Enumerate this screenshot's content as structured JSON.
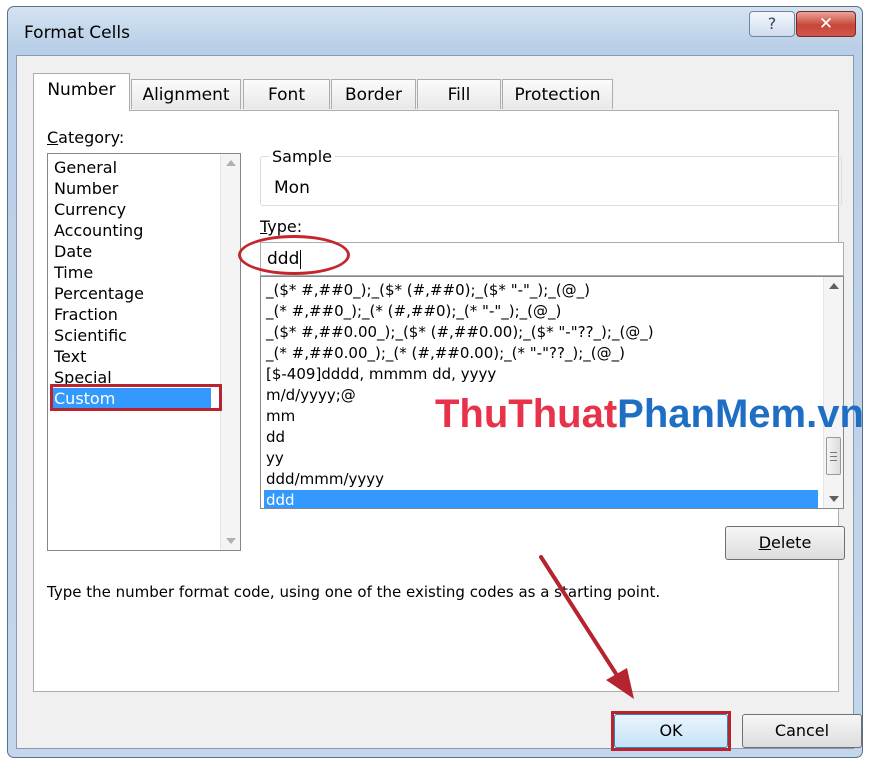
{
  "window": {
    "title": "Format Cells",
    "help_glyph": "?",
    "close_glyph": "✕"
  },
  "tabs": [
    {
      "label": "Number",
      "active": true
    },
    {
      "label": "Alignment",
      "active": false
    },
    {
      "label": "Font",
      "active": false
    },
    {
      "label": "Border",
      "active": false
    },
    {
      "label": "Fill",
      "active": false
    },
    {
      "label": "Protection",
      "active": false
    }
  ],
  "category": {
    "label_first": "C",
    "label_rest": "ategory:",
    "items": [
      "General",
      "Number",
      "Currency",
      "Accounting",
      "Date",
      "Time",
      "Percentage",
      "Fraction",
      "Scientific",
      "Text",
      "Special",
      "Custom"
    ],
    "selected": "Custom"
  },
  "sample": {
    "label": "Sample",
    "value": "Mon"
  },
  "type": {
    "label_first": "T",
    "label_rest": "ype:",
    "value": "ddd"
  },
  "format_list": {
    "items": [
      "_($* #,##0_);_($* (#,##0);_($* \"-\"_);_(@_)",
      "_(* #,##0_);_(* (#,##0);_(* \"-\"_);_(@_)",
      "_($* #,##0.00_);_($* (#,##0.00);_($* \"-\"??_);_(@_)",
      "_(* #,##0.00_);_(* (#,##0.00);_(* \"-\"??_);_(@_)",
      "[$-409]dddd, mmmm dd, yyyy",
      "m/d/yyyy;@",
      "mm",
      "dd",
      "yy",
      "ddd/mmm/yyyy",
      "ddd"
    ],
    "selected": "ddd"
  },
  "buttons": {
    "delete_first": "D",
    "delete_rest": "elete",
    "ok": "OK",
    "cancel": "Cancel"
  },
  "hint": "Type the number format code, using one of the existing codes as a starting point.",
  "watermark": {
    "part1": "ThuThuat",
    "part2": "PhanMem",
    "part3": ".vn"
  },
  "colors": {
    "selection": "#3399ff",
    "highlight_red": "#b5242f",
    "watermark_red": "#e8324a",
    "watermark_blue": "#1e6fc4"
  }
}
